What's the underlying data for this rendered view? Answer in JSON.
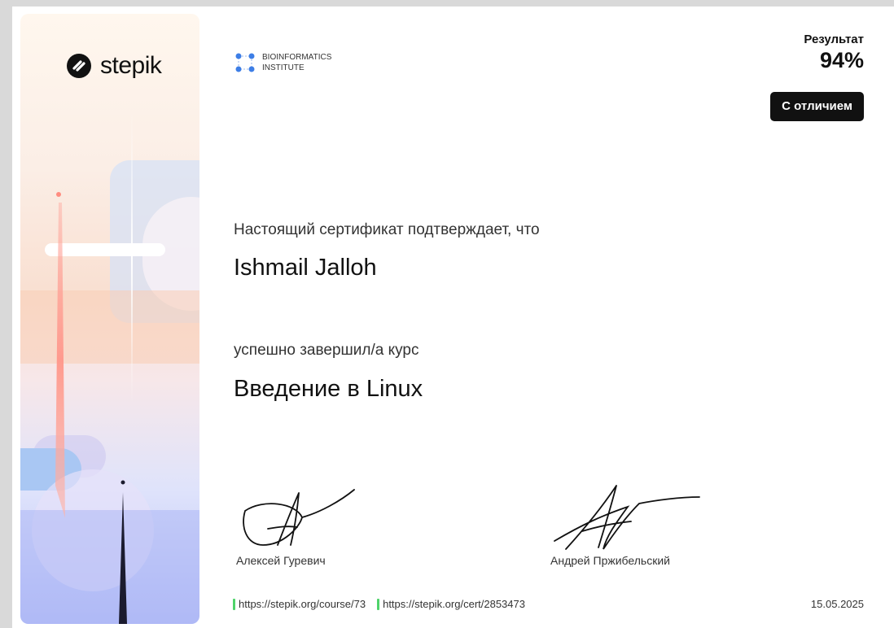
{
  "brand": {
    "name": "stepik"
  },
  "organization": {
    "line1": "BIOINFORMATICS",
    "line2": "INSTITUTE"
  },
  "result": {
    "label": "Результат",
    "value": "94%",
    "badge": "С отличием"
  },
  "certificate": {
    "confirm_text": "Настоящий сертификат подтверждает, что",
    "recipient": "Ishmail Jalloh",
    "completed_text": "успешно завершил/а  курс",
    "course": "Введение в Linux"
  },
  "signatures": [
    {
      "name": "Алексей Гуревич"
    },
    {
      "name": "Андрей Пржибельский"
    }
  ],
  "footer": {
    "course_link": "https://stepik.org/course/73",
    "cert_link": "https://stepik.org/cert/2853473",
    "date": "15.05.2025"
  },
  "colors": {
    "accent_green": "#4fd36a",
    "org_blue": "#3d7ee6",
    "badge_bg": "#111111"
  }
}
